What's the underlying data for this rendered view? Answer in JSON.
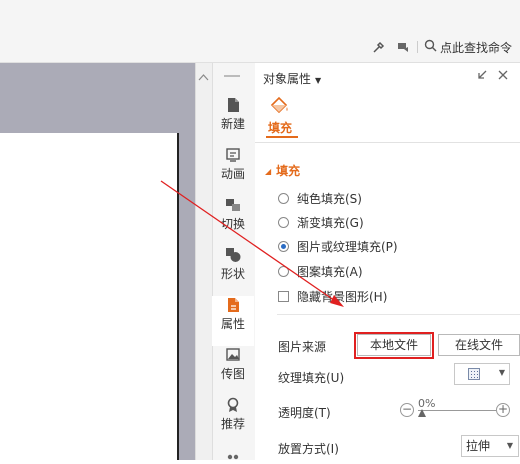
{
  "toolbar": {
    "icons": [
      "settings-icon",
      "share-icon"
    ],
    "search_label": "点此查找命令"
  },
  "strip": {
    "items": [
      {
        "label": "新建",
        "icon": "new-slide-icon"
      },
      {
        "label": "动画",
        "icon": "animation-icon"
      },
      {
        "label": "切换",
        "icon": "transition-icon"
      },
      {
        "label": "形状",
        "icon": "shape-icon"
      },
      {
        "label": "属性",
        "icon": "properties-icon"
      },
      {
        "label": "传图",
        "icon": "image-upload-icon"
      },
      {
        "label": "推荐",
        "icon": "recommend-icon"
      }
    ]
  },
  "panel": {
    "title": "对象属性",
    "tab_label": "填充",
    "section_title": "填充",
    "fill_options": [
      {
        "label": "纯色填充(S)",
        "checked": false
      },
      {
        "label": "渐变填充(G)",
        "checked": false
      },
      {
        "label": "图片或纹理填充(P)",
        "checked": true
      },
      {
        "label": "图案填充(A)",
        "checked": false
      }
    ],
    "hide_bg_label": "隐藏背景图形(H)",
    "image_source_label": "图片来源",
    "local_file_button": "本地文件",
    "online_file_button": "在线文件",
    "texture_fill_label": "纹理填充(U)",
    "transparency_label": "透明度(T)",
    "transparency_value": "0%",
    "transparency_fraction": 0,
    "placement_label": "放置方式(I)",
    "placement_value": "拉伸"
  },
  "colors": {
    "accent": "#e46b1c",
    "annotation": "#e02020",
    "selected_radio": "#2b6cc4"
  }
}
